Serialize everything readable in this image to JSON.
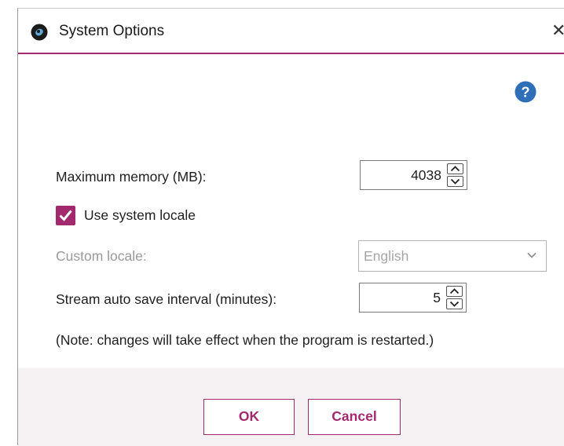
{
  "window": {
    "title": "System Options",
    "close_glyph": "✕",
    "app_icon": "app-logo-icon",
    "help_icon": "help-icon"
  },
  "colors": {
    "accent": "#a3296f",
    "help": "#2f6fb7",
    "footer_bg": "#f6f2f4"
  },
  "fields": {
    "max_memory": {
      "label": "Maximum memory (MB):",
      "value": "4038"
    },
    "use_system_locale": {
      "label": "Use system locale",
      "checked": true
    },
    "custom_locale": {
      "label": "Custom locale:",
      "value": "English",
      "disabled": true
    },
    "stream_autosave": {
      "label": "Stream auto save interval (minutes):",
      "value": "5"
    }
  },
  "note": "(Note: changes will take effect when the program is restarted.)",
  "buttons": {
    "ok": "OK",
    "cancel": "Cancel"
  }
}
